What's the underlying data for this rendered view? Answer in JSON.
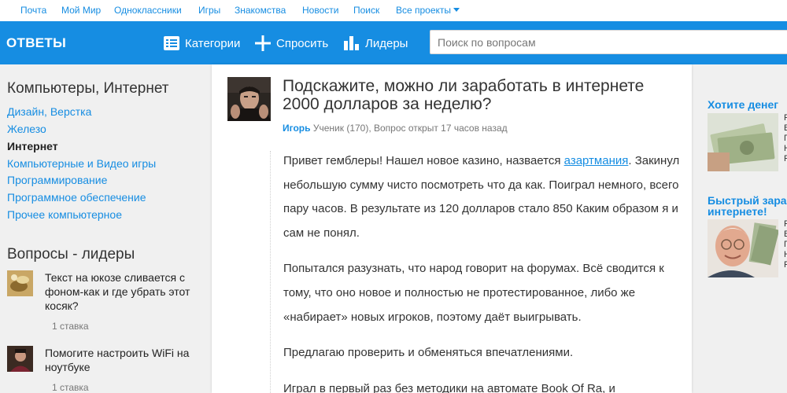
{
  "topbar": {
    "links": [
      "Почта",
      "Мой Мир",
      "Одноклассники",
      "Игры",
      "Знакомства",
      "Новости",
      "Поиск",
      "Все проекты"
    ]
  },
  "header": {
    "logo": "ОТВЕТЫ",
    "nav": {
      "categories": "Категории",
      "ask": "Спросить",
      "leaders": "Лидеры"
    },
    "search_placeholder": "Поиск по вопросам"
  },
  "sidebar": {
    "section_title": "Компьютеры, Интернет",
    "categories": [
      {
        "label": "Дизайн, Верстка",
        "active": false
      },
      {
        "label": "Железо",
        "active": false
      },
      {
        "label": "Интернет",
        "active": true
      },
      {
        "label": "Компьютерные и Видео игры",
        "active": false
      },
      {
        "label": "Программирование",
        "active": false
      },
      {
        "label": "Программное обеспечение",
        "active": false
      },
      {
        "label": "Прочее компьютерное",
        "active": false
      }
    ],
    "leaders_title": "Вопросы - лидеры",
    "leaders": [
      {
        "text": "Текст на юкозе сливается с фоном-как и где убрать этот косяк?",
        "bets": "1 ставка"
      },
      {
        "text": "Помогите настроить WiFi на ноутбуке",
        "bets": "1 ставка"
      }
    ]
  },
  "question": {
    "title": "Подскажите, можно ли заработать в интернете 2000 долларов за неделю?",
    "author": "Игорь",
    "meta": "Ученик (170), Вопрос открыт 17 часов назад",
    "paragraphs": [
      {
        "before": "Привет гемблеры! Нашел новое казино, назвается ",
        "link": "азартмания",
        "after": ". Закинул небольшую сумму чисто посмотреть что да как. Поиграл немного, всего пару часов. В результате из 120 долларов стало 850 Каким образом я и сам не понял."
      },
      {
        "text": "Попытался разузнать, что народ говорит на форумах. Всё сводится к тому, что оно новое и полностью не протестированное, либо же «набирает» новых игроков, поэтому даёт выигрывать."
      },
      {
        "text": "Предлагаю проверить и обменяться впечатлениями."
      },
      {
        "text": "Играл в первый раз без методики на автомате Book Of Ra, и"
      }
    ]
  },
  "ads": [
    {
      "title": "Хотите денег",
      "lines": [
        "Р",
        "В",
        "П",
        "Н",
        "Р"
      ]
    },
    {
      "title": "Быстрый зара",
      "title2": "интернете!",
      "lines": [
        "Р",
        "В",
        "П",
        "Н",
        "Р"
      ]
    }
  ],
  "colors": {
    "brand_blue": "#168de2",
    "page_bg": "#f0f0f0",
    "card_bg": "#ffffff"
  },
  "icons": {
    "categories": "list-icon",
    "ask": "plus-icon",
    "leaders": "bar-chart-icon",
    "dropdown": "caret-down-icon"
  }
}
